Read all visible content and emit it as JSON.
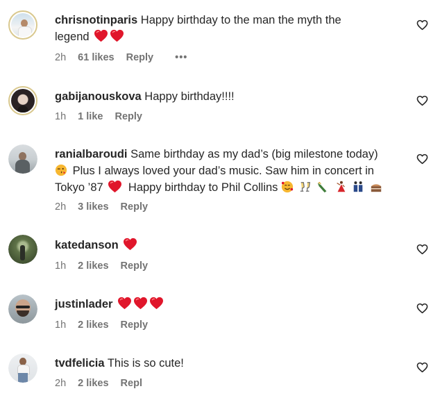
{
  "comments": [
    {
      "username": "chrisnotinparis",
      "text_line1": "Happy birthday to the man the myth the",
      "text_line2": "legend",
      "time": "2h",
      "likes": "61 likes",
      "reply": "Reply",
      "more": "•••",
      "heart_emoji_count": 2
    },
    {
      "username": "gabijanouskova",
      "text": "Happy birthday!!!!",
      "time": "1h",
      "likes": "1 like",
      "reply": "Reply"
    },
    {
      "username": "ranialbaroudi",
      "text_line1": "Same birthday as my dad’s (big milestone today)",
      "text_line2": "Plus I always loved your dad’s music. Saw him in concert in",
      "text_line3a": "Tokyo ’87",
      "text_line3b": "Happy birthday to Phil Collins",
      "time": "2h",
      "likes": "3 likes",
      "reply": "Reply",
      "emojis": [
        "winking-kiss-emoji",
        "red-heart-emoji",
        "smiling-hearts-emoji",
        "clinking-glasses-emoji",
        "champagne-emoji",
        "dancer-emoji",
        "dancers-emoji",
        "cake-emoji"
      ]
    },
    {
      "username": "katedanson",
      "text": "",
      "time": "1h",
      "likes": "2 likes",
      "reply": "Reply",
      "heart_emoji_count": 1
    },
    {
      "username": "justinlader",
      "text": "",
      "time": "1h",
      "likes": "2 likes",
      "reply": "Reply",
      "heart_emoji_count": 3
    },
    {
      "username": "tvdfelicia",
      "text": "This is so cute!",
      "time": "2h",
      "likes": "2 likes",
      "reply": "Repl"
    }
  ],
  "colors": {
    "text": "#262626",
    "meta": "#737373",
    "heart": "#e0162b",
    "story_ring": "#d9c88e"
  }
}
